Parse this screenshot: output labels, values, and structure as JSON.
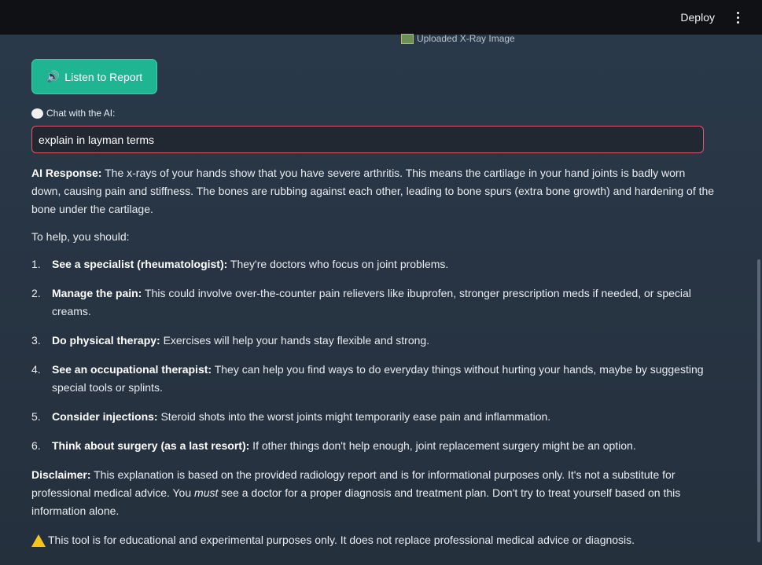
{
  "topbar": {
    "deploy_label": "Deploy"
  },
  "image_caption": "Uploaded X-Ray Image",
  "listen_button": "Listen to Report",
  "chat": {
    "label": "Chat with the AI:",
    "value": "explain in layman terms"
  },
  "response": {
    "lead_label": "AI Response:",
    "lead_text": " The x-rays of your hands show that you have severe arthritis. This means the cartilage in your hand joints is badly worn down, causing pain and stiffness. The bones are rubbing against each other, leading to bone spurs (extra bone growth) and hardening of the bone under the cartilage.",
    "help_intro": "To help, you should:",
    "steps": [
      {
        "num": "1.",
        "title": "See a specialist (rheumatologist):",
        "text": " They're doctors who focus on joint problems."
      },
      {
        "num": "2.",
        "title": "Manage the pain:",
        "text": " This could involve over-the-counter pain relievers like ibuprofen, stronger prescription meds if needed, or special creams."
      },
      {
        "num": "3.",
        "title": "Do physical therapy:",
        "text": " Exercises will help your hands stay flexible and strong."
      },
      {
        "num": "4.",
        "title": "See an occupational therapist:",
        "text": " They can help you find ways to do everyday things without hurting your hands, maybe by suggesting special tools or splints."
      },
      {
        "num": "5.",
        "title": "Consider injections:",
        "text": " Steroid shots into the worst joints might temporarily ease pain and inflammation."
      },
      {
        "num": "6.",
        "title": "Think about surgery (as a last resort):",
        "text": " If other things don't help enough, joint replacement surgery might be an option."
      }
    ],
    "disclaimer_label": "Disclaimer:",
    "disclaimer_text_1": " This explanation is based on the provided radiology report and is for informational purposes only. It's not a substitute for professional medical advice. You ",
    "disclaimer_emph": "must",
    "disclaimer_text_2": " see a doctor for a proper diagnosis and treatment plan. Don't try to treat yourself based on this information alone."
  },
  "warning": "This tool is for educational and experimental purposes only. It does not replace professional medical advice or diagnosis.",
  "icons": {
    "caption": "image-icon",
    "listen": "speaker-icon",
    "chat": "speech-bubble-icon",
    "warning": "warning-icon",
    "menu": "kebab-menu-icon"
  }
}
